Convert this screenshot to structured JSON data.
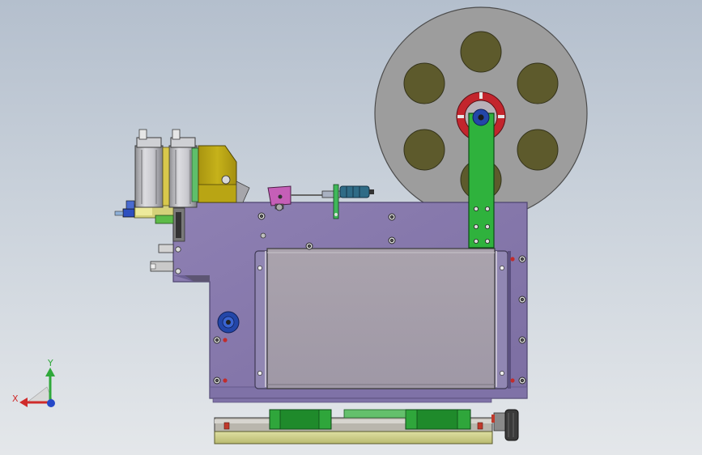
{
  "viewport": {
    "background_top": "#b4bfcd",
    "background_bottom": "#e4e7ea"
  },
  "colors": {
    "plate_purple": "#8677aa",
    "plate_edge": "#4e4470",
    "reel_disc": "#9d9d9d",
    "reel_hole": "#5d5a2c",
    "hub_red": "#c3252d",
    "hub_blue": "#2346a8",
    "arm_green": "#2fb23d",
    "steel_gray": "#a8a2ac",
    "yellow_block": "#c0ab14",
    "magenta_block": "#c55fb7",
    "rail_olive": "#cfd08a"
  },
  "triad": {
    "x_label": "X",
    "y_label": "Y",
    "x_color": "#cf2b2b",
    "y_color": "#2fa83a",
    "z_color": "#2548c8"
  }
}
